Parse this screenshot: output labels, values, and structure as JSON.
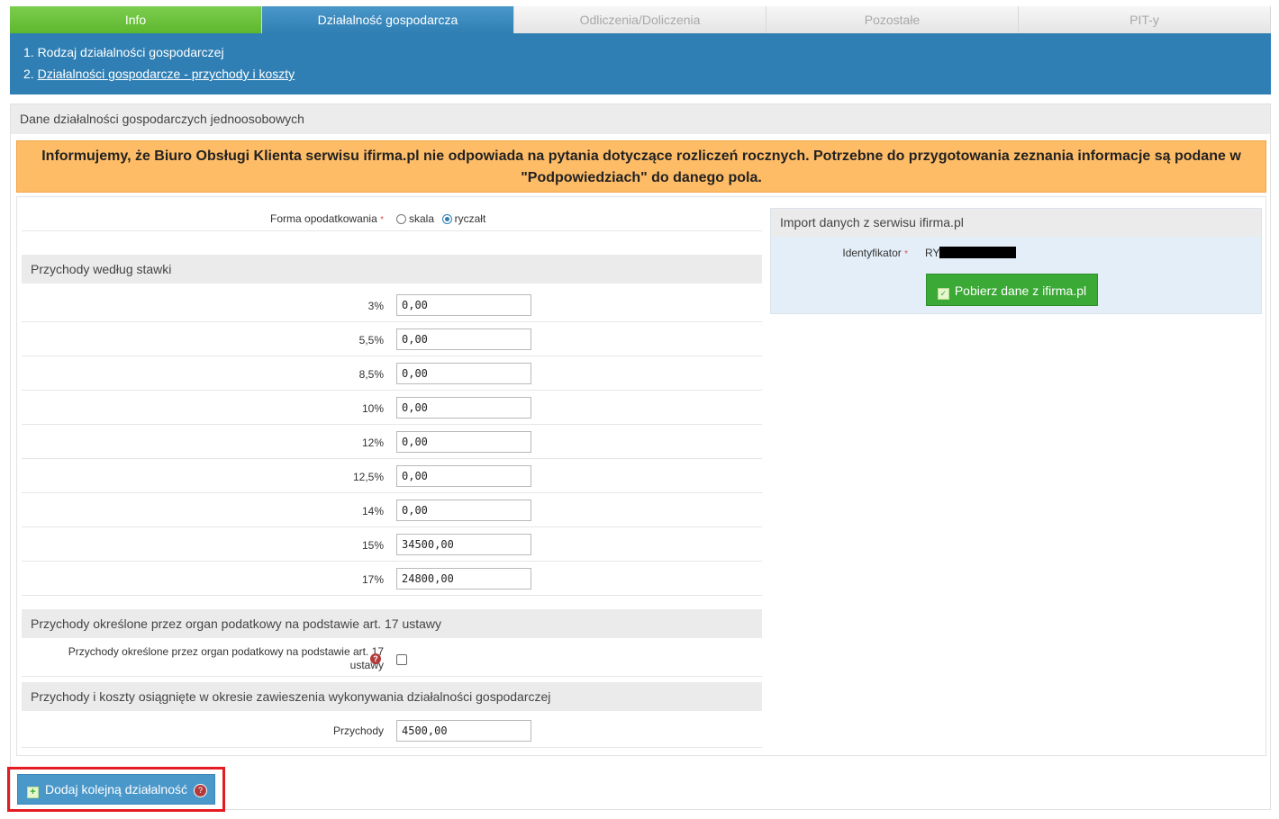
{
  "tabs": [
    "Info",
    "Działalność gospodarcza",
    "Odliczenia/Doliczenia",
    "Pozostałe",
    "PIT-y"
  ],
  "steps": {
    "step1": "1. Rodzaj działalności gospodarczej",
    "step2_prefix": "2. ",
    "step2_link": "Działalności gospodarcze - przychody i koszty"
  },
  "main": {
    "title": "Dane działalności gospodarczych jednoosobowych",
    "notice": "Informujemy, że Biuro Obsługi Klienta serwisu ifirma.pl nie odpowiada na pytania dotyczące rozliczeń rocznych. Potrzebne do przygotowania zeznania informacje są podane w \"Podpowiedziach\" do danego pola."
  },
  "form": {
    "taxation_label": "Forma opodatkowania",
    "required_mark": "*",
    "taxation_options": [
      "skala",
      "ryczałt"
    ],
    "taxation_selected": "ryczałt",
    "rates_section": "Przychody według stawki",
    "rates": [
      {
        "label": "3%",
        "value": "0,00"
      },
      {
        "label": "5,5%",
        "value": "0,00"
      },
      {
        "label": "8,5%",
        "value": "0,00"
      },
      {
        "label": "10%",
        "value": "0,00"
      },
      {
        "label": "12%",
        "value": "0,00"
      },
      {
        "label": "12,5%",
        "value": "0,00"
      },
      {
        "label": "14%",
        "value": "0,00"
      },
      {
        "label": "15%",
        "value": "34500,00"
      },
      {
        "label": "17%",
        "value": "24800,00"
      }
    ],
    "art17_section": "Przychody określone przez organ podatkowy na podstawie art. 17 ustawy",
    "art17_label_line1": "Przychody określone przez organ podatkowy na podstawie art. 17",
    "art17_label_line2": "ustawy",
    "art17_checked": false,
    "suspension_section": "Przychody i koszty osiągnięte w okresie zawieszenia wykonywania działalności gospodarczej",
    "suspension_income_label": "Przychody",
    "suspension_income_value": "4500,00"
  },
  "import": {
    "title": "Import danych z serwisu ifirma.pl",
    "id_label": "Identyfikator",
    "id_value_visible": "RY",
    "button_label": "Pobierz dane z ifirma.pl"
  },
  "footer": {
    "add_button": "Dodaj kolejną działalność",
    "help_glyph": "?"
  },
  "colors": {
    "tab_info": "#5db82e",
    "tab_active": "#2f7fb4",
    "notice_bg": "#ffbc66",
    "import_button": "#3ba935",
    "highlight_border": "#e41b23"
  }
}
